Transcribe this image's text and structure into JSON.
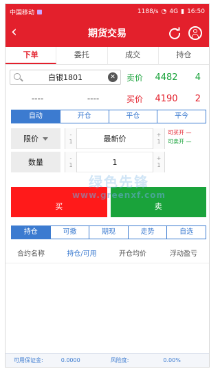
{
  "status_bar": {
    "carrier": "中国移动",
    "speed": "1188/s",
    "network": "4G",
    "time": "16:50"
  },
  "title_bar": {
    "title": "期货交易",
    "back_icon": "chevron-left-icon",
    "refresh_icon": "refresh-icon",
    "user_icon": "user-icon"
  },
  "tabs": [
    {
      "label": "下单",
      "active": true
    },
    {
      "label": "委托",
      "active": false
    },
    {
      "label": "成交",
      "active": false
    },
    {
      "label": "持仓",
      "active": false
    }
  ],
  "quote": {
    "contract": "白银1801",
    "sell_label": "卖价",
    "sell_price": "4482",
    "sell_volume": "4",
    "buy_label": "买价",
    "buy_price": "4190",
    "buy_volume": "2",
    "placeholder_left": "----",
    "placeholder_right": "----"
  },
  "open_close_modes": [
    {
      "label": "自动",
      "active": true
    },
    {
      "label": "开仓",
      "active": false
    },
    {
      "label": "平仓",
      "active": false
    },
    {
      "label": "平今",
      "active": false
    }
  ],
  "price_control": {
    "label": "限价",
    "value": "最新价",
    "minus": "-",
    "minus_step": "1",
    "plus": "+",
    "plus_step": "1"
  },
  "quantity_control": {
    "label": "数量",
    "value": "1",
    "minus": "-",
    "minus_step": "1",
    "plus": "+",
    "plus_step": "1"
  },
  "available": {
    "buy_open_label": "可买开",
    "buy_open_value": "—",
    "sell_open_label": "可卖开",
    "sell_open_value": "—"
  },
  "watermark": {
    "text": "绿色先锋",
    "url": "www.greenxf.com"
  },
  "buttons": {
    "buy": "买",
    "sell": "卖"
  },
  "position_tabs": [
    {
      "label": "持仓",
      "active": true
    },
    {
      "label": "可撤",
      "active": false
    },
    {
      "label": "期现",
      "active": false
    },
    {
      "label": "走势",
      "active": false
    },
    {
      "label": "自选",
      "active": false
    }
  ],
  "columns": [
    "合约名称",
    "持仓/可用",
    "开仓均价",
    "浮动盈亏"
  ],
  "footer": {
    "margin_label": "可用保证金:",
    "margin_value": "0.0000",
    "risk_label": "风险度:",
    "risk_value": "0.00%"
  },
  "colors": {
    "brand_red": "#e3202c",
    "buy_red": "#ff1a1a",
    "sell_green": "#1aa33b",
    "accent_blue": "#3c7bd0"
  }
}
